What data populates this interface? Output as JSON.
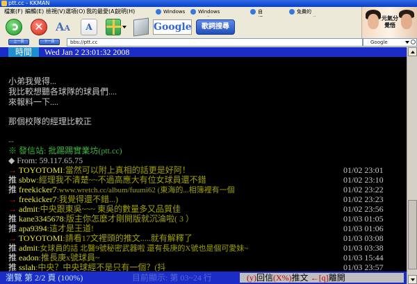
{
  "window": {
    "title": "ptt.cc - KKMAN"
  },
  "menu": [
    "檔案(F)",
    "編輯(E)",
    "檢視(V)",
    "選項(O)",
    "我的最愛(A)",
    "說明(H)"
  ],
  "quicklinks": [
    "Windows",
    "Windows Media",
    "自訂連結",
    "免費的 Hotmail"
  ],
  "toolbar": {
    "google": "Google",
    "search_button": "歌詞搜尋",
    "font_color_label": "A"
  },
  "logo_text": "元氣分 覺悟",
  "nav": {
    "back": "上一頁",
    "next": "下一頁"
  },
  "address": {
    "value": "bbs://ptt.cc"
  },
  "google_search": {
    "label": "Google"
  },
  "header": {
    "label": "時間",
    "value": "Wed Jan  2 23:01:32 2008"
  },
  "body_lines": [
    "小弟我覺得...",
    "我比較想聽各球隊的球員們....",
    "來報料一下....",
    "",
    "那個校隊的經理比較正"
  ],
  "separator": "--",
  "signature": {
    "site": "※ 發信站: 批踢踢實業坊(ptt.cc)",
    "from": "◆ From: 59.117.65.75"
  },
  "pushes": [
    {
      "tag": "→",
      "user": "TOYOTOMI",
      "comment": ":當然可以附上真相的話更是好阿！",
      "time": "01/02 23:01"
    },
    {
      "tag": "推",
      "user": "sbbw",
      "comment": ":經理我不清楚~~不過高應大有位女球員還不錯",
      "time": "01/02 23:10"
    },
    {
      "tag": "推",
      "user": "freekicker7",
      "comment": ":www.wretch.cc/album/fuumi62 (東海的...相簿裡有一個",
      "time": "01/02 23:22"
    },
    {
      "tag": "→",
      "user": "freekicker7",
      "comment": ":我覺得還不錯...)",
      "time": "01/02 23:23"
    },
    {
      "tag": "→",
      "user": "admit",
      "comment": ":中央跟東吳~~~ 東吳的數量多又品質佳",
      "time": "01/02 23:56"
    },
    {
      "tag": "推",
      "user": "kane3345678",
      "comment": ":版主你怎麼才剛開版就沉淪啦(   3   ）",
      "time": "01/03 01:05"
    },
    {
      "tag": "推",
      "user": "apa9394",
      "comment": ":這才是王道!",
      "time": "01/03 01:06"
    },
    {
      "tag": "→",
      "user": "TOYOTOMI",
      "comment": ":請看17文裡頭的推文.....就有解釋了",
      "time": "01/03 03:08"
    },
    {
      "tag": "推",
      "user": "admit",
      "comment": ":女球員的話 北醫9號秘密武器啦 還有長庚的X號也是個可愛妹~",
      "time": "01/03 03:38"
    },
    {
      "tag": "推",
      "user": "eadon",
      "comment": ":推長庚x號球員~",
      "time": "01/03 15:44"
    },
    {
      "tag": "推",
      "user": "sslah",
      "comment": ":中央？中央球經不是只有一個？(抖",
      "time": "01/03 23:57"
    }
  ],
  "status": {
    "browse": "瀏覽 第 2/2 頁 (100%)",
    "showing": "目前顯示: 第 03~24 行",
    "reply_prefix": "(y)",
    "reply": "回信",
    "push_prefix": "(X%)",
    "push": "推文",
    "leave_prefix": "←[q]",
    "leave": "離開"
  }
}
